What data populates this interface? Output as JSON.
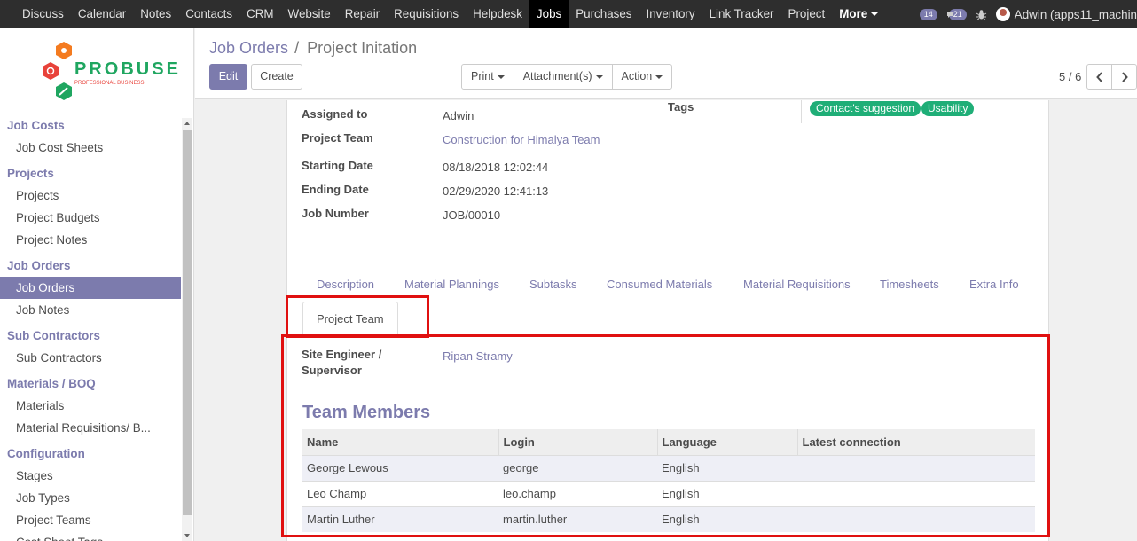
{
  "topnav": {
    "menu": [
      "Discuss",
      "Calendar",
      "Notes",
      "Contacts",
      "CRM",
      "Website",
      "Repair",
      "Requisitions",
      "Helpdesk",
      "Jobs",
      "Purchases",
      "Inventory",
      "Link Tracker",
      "Project"
    ],
    "active": "Jobs",
    "more_label": "More",
    "activity_count": "14",
    "message_count": "21",
    "user_name": "Adwin (apps11_machin"
  },
  "sidebar": {
    "logo_text": "PROBUSE",
    "logo_subtext": "PROFESSIONAL BUSINESS",
    "sections": [
      {
        "title": "Job Costs",
        "items": [
          "Job Cost Sheets"
        ]
      },
      {
        "title": "Projects",
        "items": [
          "Projects",
          "Project Budgets",
          "Project Notes"
        ]
      },
      {
        "title": "Job Orders",
        "items": [
          "Job Orders",
          "Job Notes"
        ]
      },
      {
        "title": "Sub Contractors",
        "items": [
          "Sub Contractors"
        ]
      },
      {
        "title": "Materials / BOQ",
        "items": [
          "Materials",
          "Material Requisitions/ B..."
        ]
      },
      {
        "title": "Configuration",
        "items": [
          "Stages",
          "Job Types",
          "Project Teams",
          "Cost Sheet Tags"
        ]
      }
    ],
    "active_item": "Job Orders"
  },
  "control_panel": {
    "breadcrumb_parent": "Job Orders",
    "breadcrumb_sep": "/",
    "breadcrumb_current": "Project Initation",
    "edit_label": "Edit",
    "create_label": "Create",
    "print_label": "Print",
    "attachments_label": "Attachment(s)",
    "action_label": "Action",
    "pager": "5 / 6"
  },
  "form": {
    "fields": {
      "assigned_to_label": "Assigned to",
      "assigned_to": "Adwin",
      "project_team_label": "Project Team",
      "project_team": "Construction for Himalya Team",
      "starting_date_label": "Starting Date",
      "starting_date": "08/18/2018 12:02:44",
      "ending_date_label": "Ending Date",
      "ending_date": "02/29/2020 12:41:13",
      "job_number_label": "Job Number",
      "job_number": "JOB/00010",
      "tags_label": "Tags",
      "tags": [
        "Contact's suggestion",
        "Usability"
      ]
    },
    "tabs": [
      "Description",
      "Material Plannings",
      "Subtasks",
      "Consumed Materials",
      "Material Requisitions",
      "Timesheets",
      "Extra Info",
      "Project Team"
    ],
    "active_tab": "Project Team",
    "site_engineer_label_1": "Site Engineer /",
    "site_engineer_label_2": "Supervisor",
    "site_engineer": "Ripan Stramy",
    "team_members_title": "Team Members",
    "team_table": {
      "columns": [
        "Name",
        "Login",
        "Language",
        "Latest connection"
      ],
      "rows": [
        [
          "George Lewous",
          "george",
          "English",
          ""
        ],
        [
          "Leo Champ",
          "leo.champ",
          "English",
          ""
        ],
        [
          "Martin Luther",
          "martin.luther",
          "English",
          ""
        ]
      ]
    }
  },
  "colors": {
    "brand": "#7c7bad",
    "tag": "#1fae77",
    "highlight": "#e01010",
    "topbar": "#2e2e2e"
  }
}
